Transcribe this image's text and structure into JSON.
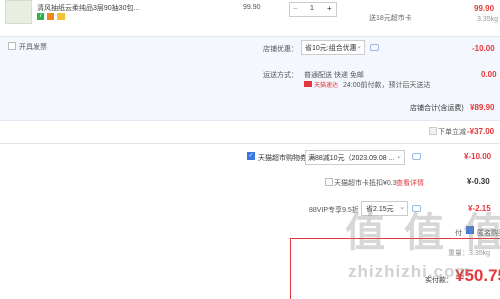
{
  "colors": {
    "accent": "#e4393c",
    "panel": "#f4f7fd",
    "brand_green": "#2fb14a",
    "brand_orange": "#f08a1e",
    "check_blue": "#3a7ae0"
  },
  "product": {
    "title": "清风抽纸云柔纯品3层90抽30包...",
    "badge_a": "7",
    "unit_price": "99.90",
    "quantity": "1",
    "minus": "−",
    "plus": "+",
    "subtotal": "99.90",
    "weight": "3.35kg",
    "supermarket_card": "送18元超市卡"
  },
  "invoice": {
    "label": "开具发票"
  },
  "store_discount": {
    "label": "店铺优惠：",
    "value": "省10元:组合优惠",
    "amount": "-10.00"
  },
  "shipping": {
    "label": "运送方式：",
    "methods": "普通配送 快递 免邮",
    "brand": "天猫速达",
    "note": "24:00前付款，预计后天送达",
    "fee": "0.00"
  },
  "store_total": {
    "label": "店铺合计(含运费)",
    "amount": "¥89.90"
  },
  "instant_discount": {
    "label": "下单立减",
    "amount": "-¥37.00"
  },
  "coupon": {
    "label": "天猫超市购物券",
    "value": "满88减10元（2023.09.08 ...",
    "amount": "¥-10.00"
  },
  "card_deduct": {
    "label": "天猫超市卡抵扣¥0.3",
    "link": "查看详情",
    "amount": "¥-0.30"
  },
  "vip": {
    "label": "88VIP专享9.5折",
    "value": "省2.15元",
    "amount": "¥-2.15"
  },
  "footer": {
    "check_label": "付",
    "anonymous": "匿名购买",
    "weight": "重量：3.35kg",
    "actual_label": "实付款：",
    "actual_amount": "¥50.75"
  },
  "watermark": "值 值 值",
  "watermark_url": "zhizhizhi.com"
}
